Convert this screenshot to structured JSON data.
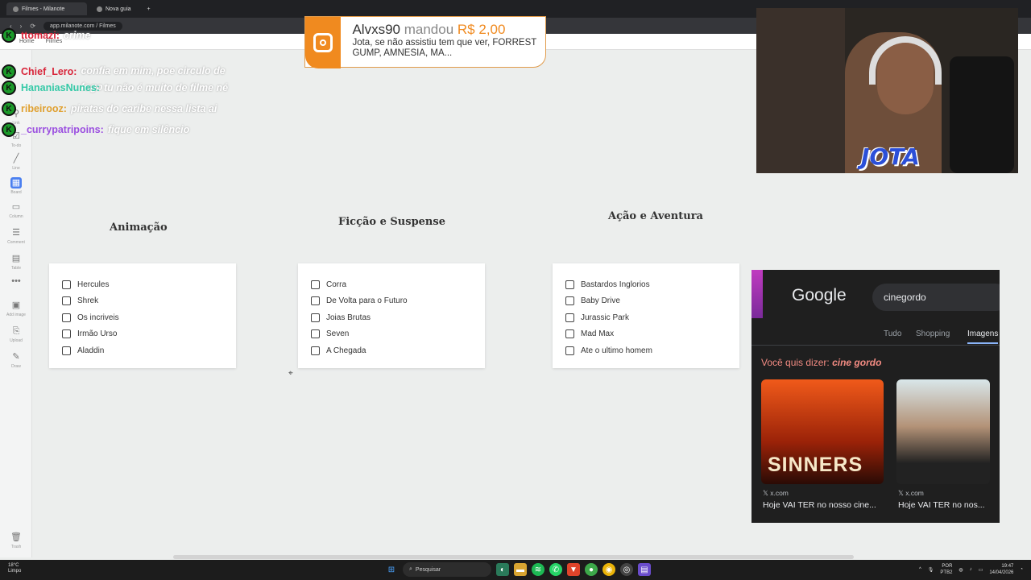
{
  "browser": {
    "tabs": [
      {
        "label": "Filmes - Milanote",
        "active": true
      },
      {
        "label": "Nova guia",
        "active": false
      }
    ],
    "new_tab": "+",
    "url": "app.milanote.com / Filmes"
  },
  "app_header": {
    "home": "Home",
    "board": "Filmes"
  },
  "sidebar": {
    "items": [
      {
        "label": "Link",
        "icon": "link-icon"
      },
      {
        "label": "To-do",
        "icon": "todo-icon"
      },
      {
        "label": "Line",
        "icon": "line-icon"
      },
      {
        "label": "Board",
        "icon": "board-icon",
        "active": true
      },
      {
        "label": "Column",
        "icon": "column-icon"
      },
      {
        "label": "Comment",
        "icon": "comment-icon"
      },
      {
        "label": "Table",
        "icon": "table-icon"
      },
      {
        "label": "",
        "icon": "more-icon"
      },
      {
        "label": "Add image",
        "icon": "image-icon"
      },
      {
        "label": "Upload",
        "icon": "upload-icon"
      },
      {
        "label": "Draw",
        "icon": "draw-icon"
      },
      {
        "label": "Trash",
        "icon": "trash-icon"
      }
    ]
  },
  "columns": [
    {
      "title": "Animação",
      "items": [
        "Hercules",
        "Shrek",
        "Os incriveis",
        "Irmão Urso",
        "Aladdin"
      ]
    },
    {
      "title": "Ficção e Suspense",
      "items": [
        "Corra",
        "De Volta para o Futuro",
        "Joias Brutas",
        "Seven",
        "A Chegada"
      ]
    },
    {
      "title": "Ação e Aventura",
      "items": [
        "Bastardos Inglorios",
        "Baby Drive",
        "Jurassic Park",
        "Mad Max",
        "Ate o ultimo homem"
      ]
    }
  ],
  "chat": [
    {
      "user": "ttomazi:",
      "message": "crime",
      "color": "#d8253a"
    },
    {
      "user": "Chief_Lero:",
      "message": "confia em mim, poe circulo de fogo",
      "color": "#d8253a"
    },
    {
      "user": "HananiasNunes:",
      "message": "tu não é muito de filme né",
      "color": "#35c9a7"
    },
    {
      "user": "ribeirooz:",
      "message": "piratas do caribe nessa lista ai",
      "color": "#e0a030"
    },
    {
      "user": "_currypatripoins:",
      "message": "fique em silêncio",
      "color": "#9b4fe0"
    }
  ],
  "chat_badge": "K",
  "donation": {
    "name": "Alvxs90",
    "verb": "mandou",
    "amount": "R$ 2,00",
    "message": "Jota, se não assistiu tem que ver, FORREST GUMP, AMNESIA, MA..."
  },
  "webcam": {
    "overlay_logo": "JOTA"
  },
  "google": {
    "logo": "Google",
    "query": "cinegordo",
    "tabs": [
      "Tudo",
      "Shopping",
      "Imagens"
    ],
    "active_tab": "Imagens",
    "did_you_mean_label": "Você quis dizer:",
    "did_you_mean_value": "cine gordo",
    "results": [
      {
        "poster_text": "SINNERS",
        "source": "x.com",
        "caption": "Hoje VAI TER no nosso cine..."
      },
      {
        "poster_text": "",
        "source": "x.com",
        "caption": "Hoje VAI TER no nos..."
      }
    ]
  },
  "taskbar": {
    "temperature": "18°C",
    "weather": "Limpo",
    "search_placeholder": "Pesquisar",
    "language": "POR",
    "keyboard": "PTB2",
    "time": "19:47",
    "date": "14/04/2026"
  }
}
